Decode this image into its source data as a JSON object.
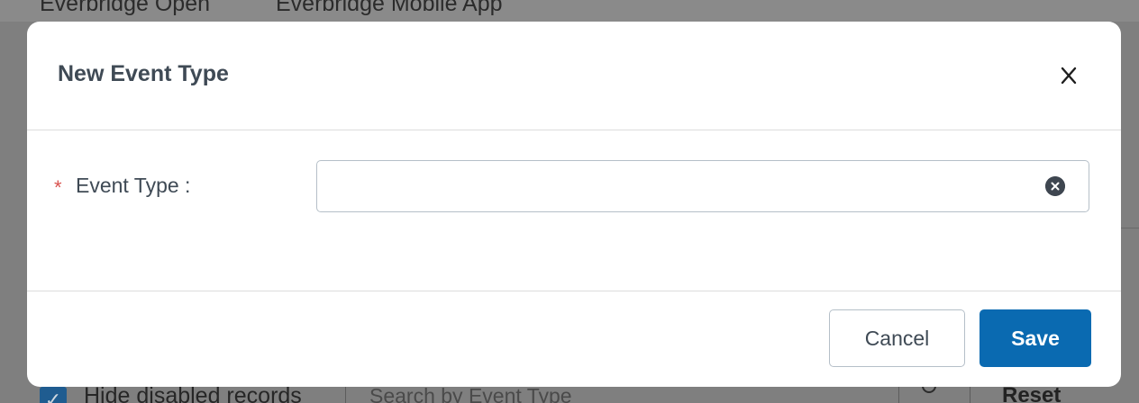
{
  "background": {
    "tabs": [
      "Everbridge Open",
      "Everbridge Mobile App"
    ],
    "hide_disabled_label": "Hide disabled records",
    "search_placeholder": "Search by Event Type",
    "reset_label": "Reset"
  },
  "modal": {
    "title": "New Event Type",
    "close_label": "X",
    "field": {
      "required_mark": "*",
      "label": "Event Type :",
      "value": "",
      "placeholder": ""
    },
    "cancel_label": "Cancel",
    "save_label": "Save"
  },
  "colors": {
    "accent": "#0a6ab1",
    "required": "#d9534f",
    "overlay": "#7f7f7f"
  }
}
